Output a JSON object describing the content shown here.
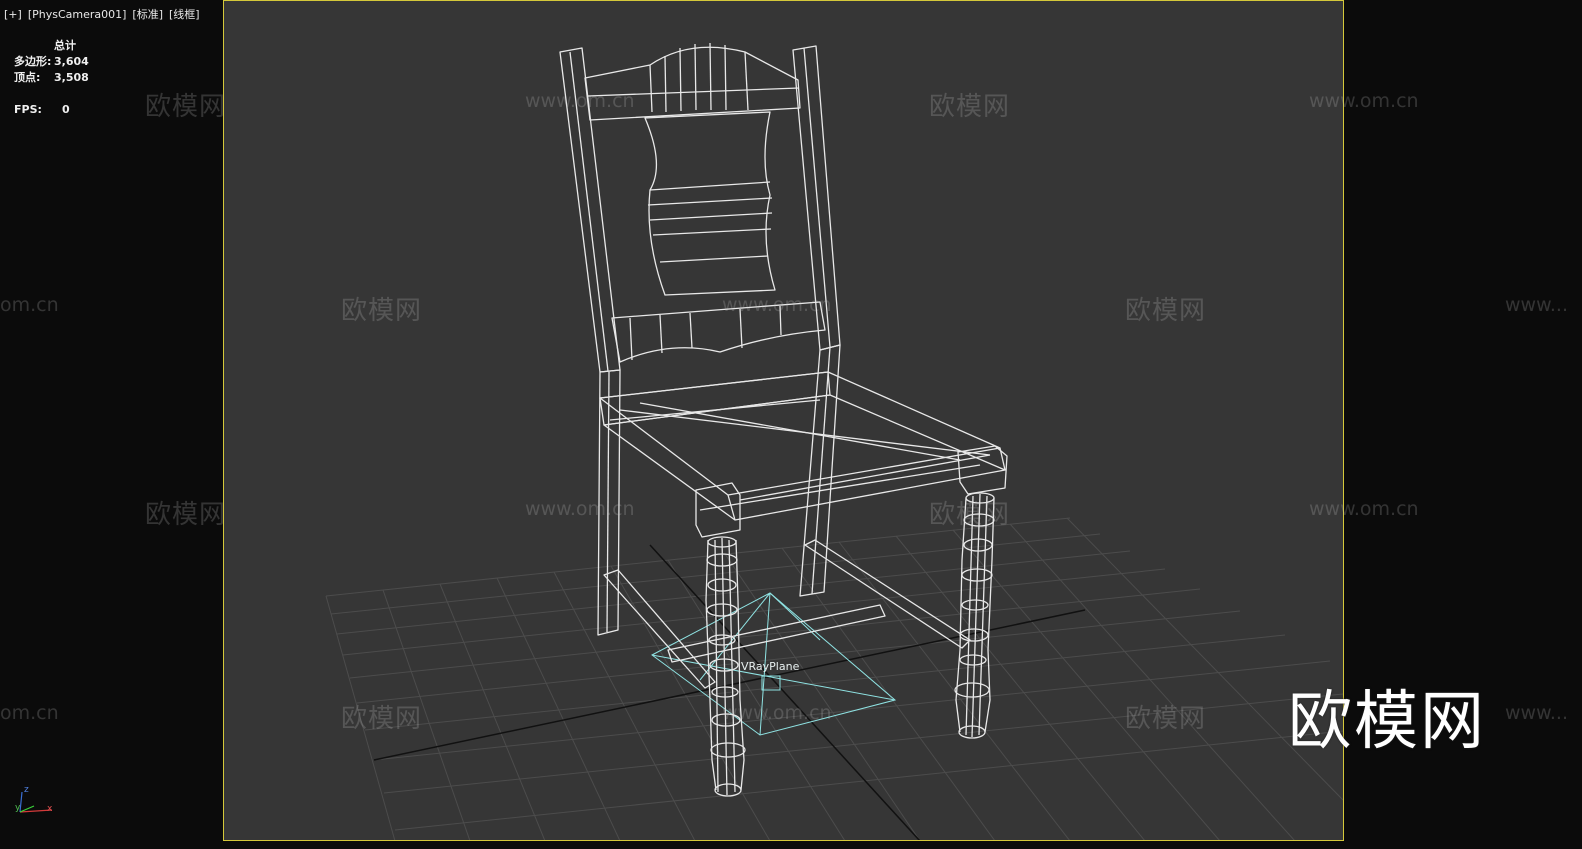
{
  "viewport": {
    "label_menu": "[+]",
    "label_camera": "[PhysCamera001]",
    "label_shading": "[标准]",
    "label_display": "[线框]"
  },
  "stats": {
    "header": "总计",
    "polys_label": "多边形:",
    "polys_value": "3,604",
    "verts_label": "顶点:",
    "verts_value": "3,508",
    "fps_label": "FPS:",
    "fps_value": "0"
  },
  "scene": {
    "object_label": "VRayPlane",
    "watermark_cn": "欧模网",
    "watermark_en": "www.om.cn",
    "watermark_en_partial": "om.cn",
    "watermark_en_partial_right": "www...",
    "logo": "欧模网"
  },
  "axis": {
    "x": "x",
    "y": "y",
    "z": "z"
  },
  "colors": {
    "frame": "#d4c83a",
    "viewport_bg": "#363636",
    "wire": "#e6e6e6",
    "light": "#7fd8d8",
    "grid": "#4a4a4a"
  }
}
